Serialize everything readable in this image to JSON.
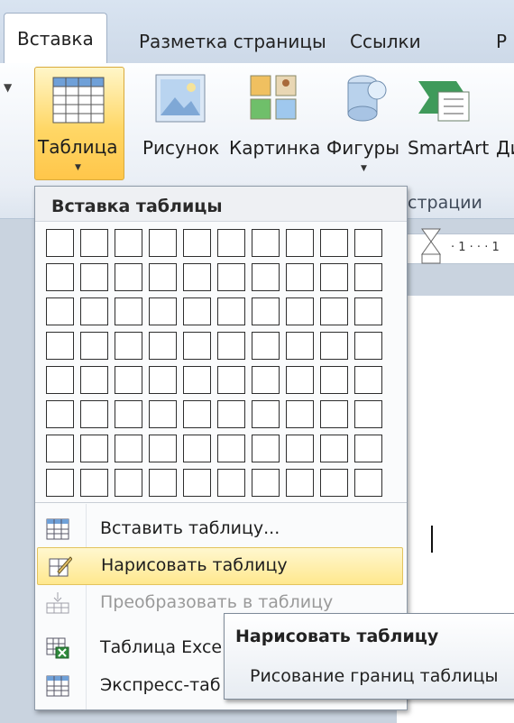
{
  "tabs": [
    {
      "label": "Вставка",
      "active": true
    },
    {
      "label": "Разметка страницы",
      "active": false
    },
    {
      "label": "Ссылки",
      "active": false
    },
    {
      "label": "Р",
      "active": false
    }
  ],
  "ribbon": {
    "buttons": {
      "table": {
        "label": "Таблица",
        "icon": "table-icon"
      },
      "picture": {
        "label": "Рисунок",
        "icon": "picture-icon"
      },
      "clipart": {
        "label": "Картинка",
        "icon": "clipart-icon"
      },
      "shapes": {
        "label": "Фигуры",
        "icon": "shapes-icon"
      },
      "smartart": {
        "label": "SmartArt",
        "icon": "smartart-icon"
      },
      "more": {
        "label": "Ди"
      }
    },
    "group_label": "страции"
  },
  "ruler_text": "· 1 · · · 1",
  "dropdown": {
    "header": "Вставка таблицы",
    "grid": {
      "columns": 10,
      "rows": 8
    },
    "items": [
      {
        "label": "Вставить таблицу...",
        "icon": "insert-table-icon",
        "highlighted": false,
        "disabled": false
      },
      {
        "label": "Нарисовать таблицу",
        "icon": "draw-table-icon",
        "highlighted": true,
        "disabled": false
      },
      {
        "label": "Преобразовать в таблицу",
        "icon": "convert-table-icon",
        "highlighted": false,
        "disabled": true
      },
      {
        "label": "Таблица Exce",
        "icon": "excel-table-icon",
        "highlighted": false,
        "disabled": false
      },
      {
        "label": "Экспресс-таб",
        "icon": "quick-tables-icon",
        "highlighted": false,
        "disabled": false
      }
    ]
  },
  "tooltip": {
    "title": "Нарисовать таблицу",
    "description": "Рисование границ таблицы"
  }
}
